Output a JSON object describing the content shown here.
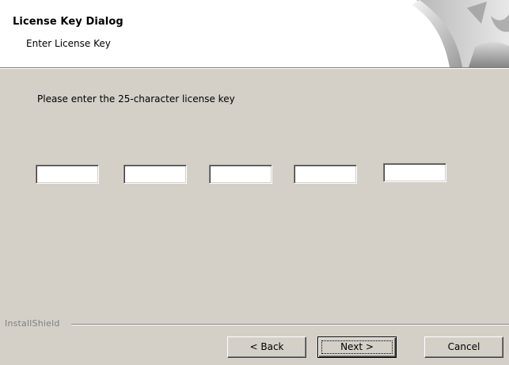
{
  "header": {
    "title": "License Key Dialog",
    "subtitle": "Enter License Key"
  },
  "body": {
    "prompt": "Please enter the 25-character license key",
    "key_fields": [
      {
        "value": ""
      },
      {
        "value": ""
      },
      {
        "value": ""
      },
      {
        "value": ""
      },
      {
        "value": ""
      }
    ]
  },
  "footer": {
    "brand": "InstallShield",
    "back_label": "< Back",
    "next_label": "Next >",
    "cancel_label": "Cancel"
  },
  "colors": {
    "dialog_bg": "#d4d0c8",
    "header_bg": "#ffffff",
    "brand_text": "#808080"
  }
}
